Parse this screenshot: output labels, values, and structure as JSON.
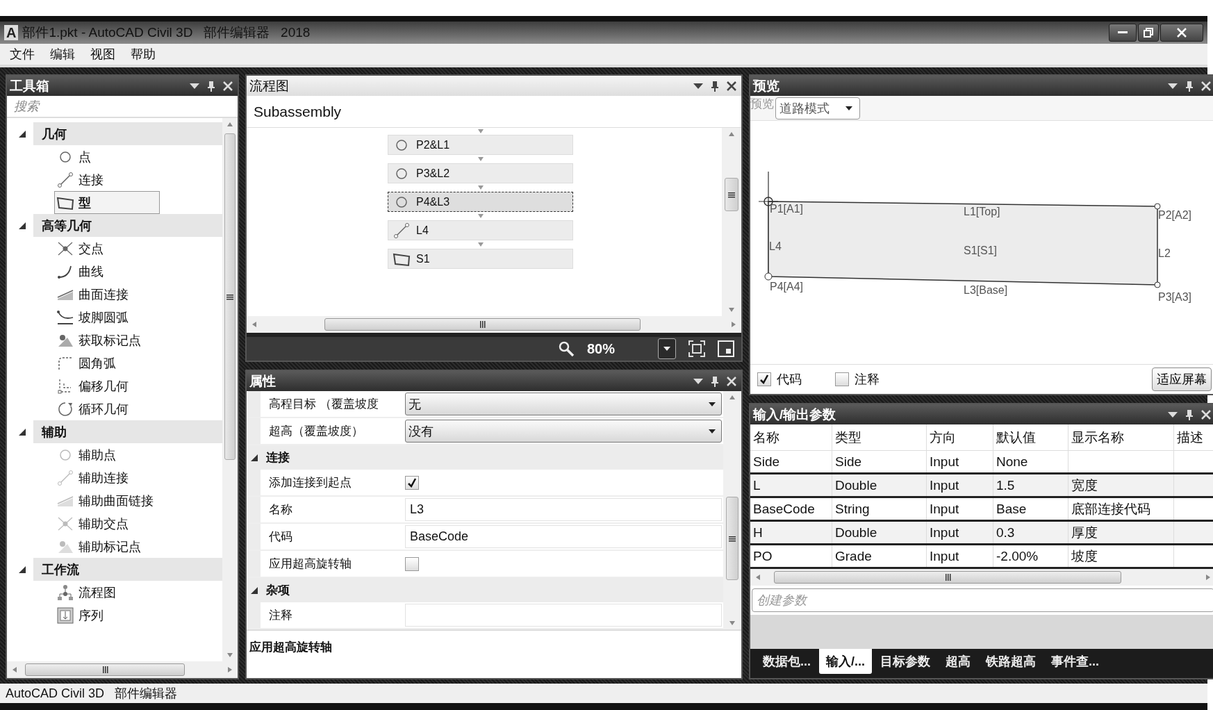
{
  "window": {
    "app_icon": "A",
    "title": "部件1.pkt - AutoCAD Civil 3D   部件编辑器   2018"
  },
  "menu": [
    "文件",
    "编辑",
    "视图",
    "帮助"
  ],
  "toolbox": {
    "title": "工具箱",
    "search": {
      "placeholder": "搜索"
    },
    "groups": [
      {
        "label": "几何",
        "expanded": true,
        "items": [
          {
            "label": "点",
            "kind": "point",
            "selected": false
          },
          {
            "label": "连接",
            "kind": "link",
            "selected": false
          },
          {
            "label": "型",
            "kind": "shape",
            "selected": true
          }
        ]
      },
      {
        "label": "高等几何",
        "expanded": true,
        "items": [
          {
            "label": "交点",
            "kind": "intersection",
            "selected": false
          },
          {
            "label": "曲线",
            "kind": "curve",
            "selected": false
          },
          {
            "label": "曲面连接",
            "kind": "surface",
            "selected": false
          },
          {
            "label": "坡脚圆弧",
            "kind": "daylight",
            "selected": false
          },
          {
            "label": "获取标记点",
            "kind": "mark",
            "selected": false
          },
          {
            "label": "圆角弧",
            "kind": "fillet",
            "selected": false
          },
          {
            "label": "偏移几何",
            "kind": "offset",
            "selected": false
          },
          {
            "label": "循环几何",
            "kind": "loop",
            "selected": false
          }
        ]
      },
      {
        "label": "辅助",
        "expanded": true,
        "items": [
          {
            "label": "辅助点",
            "kind": "point",
            "selected": false
          },
          {
            "label": "辅助连接",
            "kind": "link",
            "selected": false
          },
          {
            "label": "辅助曲面链接",
            "kind": "surface",
            "selected": false
          },
          {
            "label": "辅助交点",
            "kind": "intersection",
            "selected": false
          },
          {
            "label": "辅助标记点",
            "kind": "mark",
            "selected": false
          }
        ]
      },
      {
        "label": "工作流",
        "expanded": true,
        "items": [
          {
            "label": "流程图",
            "kind": "flowchart",
            "selected": false
          },
          {
            "label": "序列",
            "kind": "sequence",
            "selected": false
          }
        ]
      }
    ]
  },
  "flowchart": {
    "title": "流程图",
    "heading": "Subassembly",
    "steps": [
      {
        "label": "P2&L1",
        "kind": "point",
        "selected": false
      },
      {
        "label": "P3&L2",
        "kind": "point",
        "selected": false
      },
      {
        "label": "P4&L3",
        "kind": "point",
        "selected": true
      },
      {
        "label": "L4",
        "kind": "link",
        "selected": false
      },
      {
        "label": "S1",
        "kind": "shape",
        "selected": false
      }
    ],
    "zoom": "80%"
  },
  "properties": {
    "title": "属性",
    "rows": [
      {
        "kind": "dropdown",
        "label": "高程目标 （覆盖坡度",
        "value": "无"
      },
      {
        "kind": "dropdown",
        "label": "超高（覆盖坡度）",
        "value": "没有"
      },
      {
        "kind": "section",
        "label": "连接",
        "expanded": true
      },
      {
        "kind": "checkbox",
        "label": "添加连接到起点",
        "checked": true
      },
      {
        "kind": "text",
        "label": "名称",
        "value": "L3"
      },
      {
        "kind": "text",
        "label": "代码",
        "value": "BaseCode"
      },
      {
        "kind": "checkbox",
        "label": "应用超高旋转轴",
        "checked": false
      },
      {
        "kind": "section",
        "label": "杂项",
        "expanded": true
      },
      {
        "kind": "text",
        "label": "注释"
      }
    ],
    "description": "应用超高旋转轴"
  },
  "preview": {
    "title": "预览",
    "mode_label": "预览",
    "mode": "道路模式",
    "labels": [
      "P1[A1]",
      "L1[Top]",
      "P2[A2]",
      "L4",
      "S1[S1]",
      "L2",
      "P4[A4]",
      "L3[Base]",
      "P3[A3]"
    ],
    "options": [
      {
        "label": "代码",
        "checked": true
      },
      {
        "label": "注释",
        "checked": false
      }
    ],
    "fit_button": "适应屏幕"
  },
  "parameters": {
    "title": "输入/输出参数",
    "columns": [
      "名称",
      "类型",
      "方向",
      "默认值",
      "显示名称",
      "描述"
    ],
    "rows": [
      [
        "Side",
        "Side",
        "Input",
        "None",
        ""
      ],
      [
        "L",
        "Double",
        "Input",
        "1.5",
        "宽度"
      ],
      [
        "BaseCode",
        "String",
        "Input",
        "Base",
        "底部连接代码"
      ],
      [
        "H",
        "Double",
        "Input",
        "0.3",
        "厚度"
      ],
      [
        "PO",
        "Grade",
        "Input",
        "-2.00%",
        "坡度"
      ]
    ],
    "create": {
      "placeholder": "创建参数"
    },
    "tabs": [
      {
        "label": "数据包...",
        "selected": false
      },
      {
        "label": "输入/...",
        "selected": true
      },
      {
        "label": "目标参数",
        "selected": false
      },
      {
        "label": "超高",
        "selected": false
      },
      {
        "label": "铁路超高",
        "selected": false
      },
      {
        "label": "事件查...",
        "selected": false
      }
    ]
  },
  "status_bar": "AutoCAD Civil 3D   部件编辑器"
}
